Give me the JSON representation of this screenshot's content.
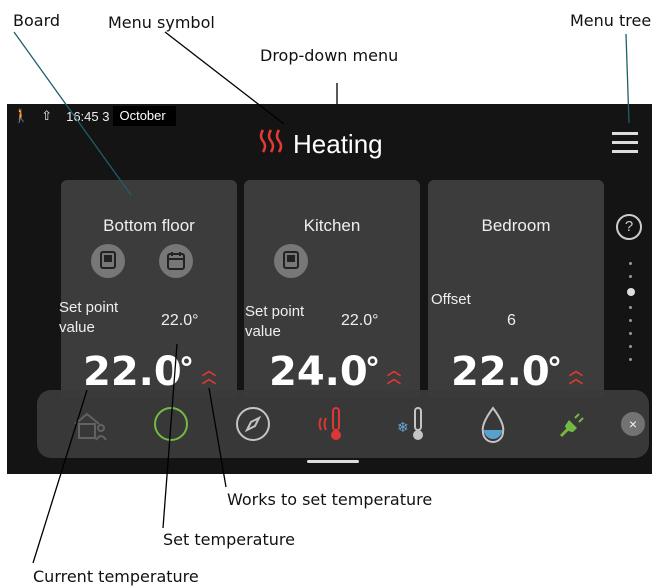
{
  "callouts": {
    "board": "Board",
    "menu_symbol": "Menu symbol",
    "menu_tree": "Menu tree",
    "drop_down_menu": "Drop-down menu",
    "works_to_set_temperature": "Works to set temperature",
    "set_temperature": "Set temperature",
    "current_temperature": "Current temperature"
  },
  "status_bar": {
    "time": "16:45 3",
    "month": "October"
  },
  "header": {
    "title": "Heating"
  },
  "cards": [
    {
      "title": "Bottom floor",
      "label": "Set point value",
      "set_value": "22.0°",
      "current": "22.0",
      "unit": "°"
    },
    {
      "title": "Kitchen",
      "label": "Set point value",
      "set_value": "22.0°",
      "current": "24.0",
      "unit": "°"
    },
    {
      "title": "Bedroom",
      "label": "Offset",
      "set_value": "6",
      "current": "22.0",
      "unit": "°"
    }
  ],
  "help": "?",
  "close": "×",
  "icons": {
    "status": [
      "person-icon",
      "export-icon"
    ],
    "menu_symbol": "heating-waves-icon",
    "menu_tree": "hamburger-menu-icon",
    "card_icons": [
      "room-unit-icon",
      "calendar-icon"
    ],
    "dock": [
      "home-person-icon",
      "circle-icon",
      "compass-icon",
      "thermometer-heat-icon",
      "thermometer-cool-icon",
      "water-drop-icon",
      "plug-icon"
    ]
  },
  "colors": {
    "screen_bg": "#141414",
    "card_bg": "#3c3c3c",
    "accent_red": "#e53935",
    "dock_green": "#7bc043"
  }
}
